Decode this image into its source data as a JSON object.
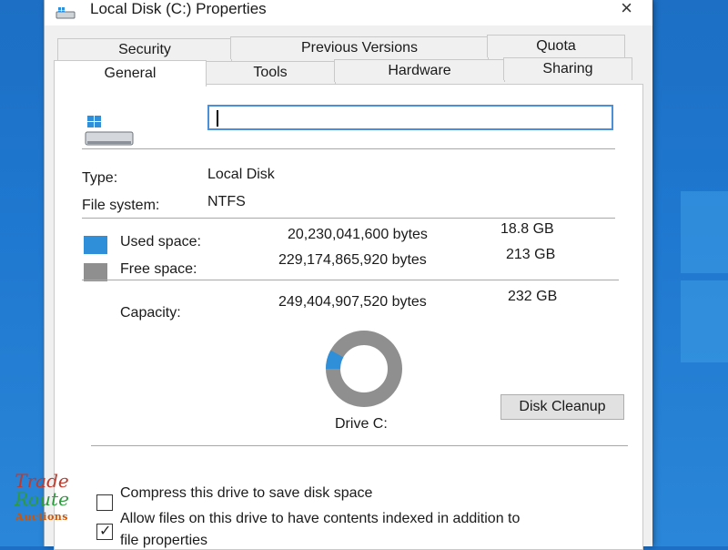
{
  "window": {
    "title": "Local Disk (C:) Properties",
    "close_label": "×"
  },
  "tabs": {
    "row1": [
      "Security",
      "Previous Versions",
      "Quota"
    ],
    "row2": [
      "General",
      "Tools",
      "Hardware",
      "Sharing"
    ],
    "active": "General"
  },
  "general": {
    "name_value": "",
    "type_label": "Type:",
    "type_value": "Local Disk",
    "fs_label": "File system:",
    "fs_value": "NTFS",
    "used_label": "Used space:",
    "used_bytes": "20,230,041,600 bytes",
    "used_gb": "18.8 GB",
    "free_label": "Free space:",
    "free_bytes": "229,174,865,920 bytes",
    "free_gb": "213 GB",
    "capacity_label": "Capacity:",
    "capacity_bytes": "249,404,907,520 bytes",
    "capacity_gb": "232 GB",
    "drive_label": "Drive C:",
    "cleanup_button": "Disk Cleanup",
    "used_fraction": 0.081,
    "compress_label": "Compress this drive to save disk space",
    "compress_checked": false,
    "index_label": "Allow files on this drive to have contents indexed in addition to",
    "index_label_2": "file properties",
    "index_checked": true
  },
  "colors": {
    "used": "#2f8fd8",
    "free": "#8f8f8f",
    "input_border": "#4a8fd8"
  },
  "watermark": {
    "line1": "Trade",
    "line2": "Route",
    "line3": "Auctions"
  }
}
